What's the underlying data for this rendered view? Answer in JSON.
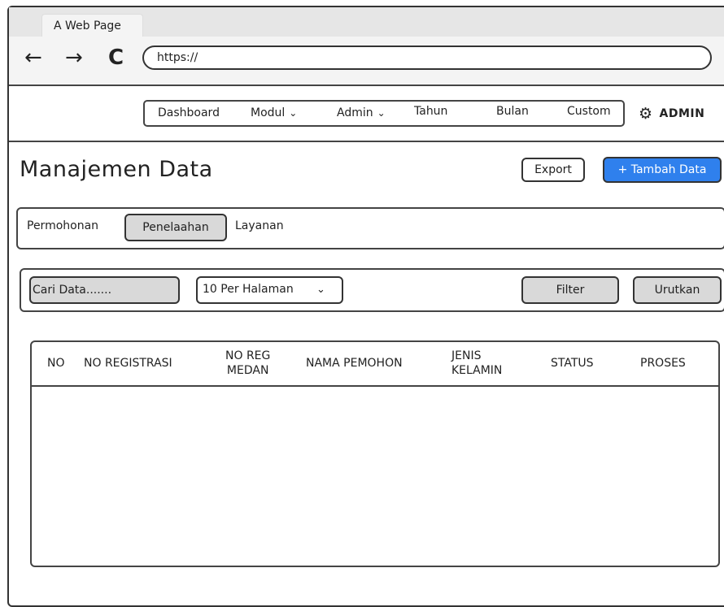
{
  "browser": {
    "tab_title": "A Web Page",
    "url": "https://",
    "back_icon": "←",
    "forward_icon": "→",
    "reload_icon": "C"
  },
  "nav": {
    "items": [
      {
        "label": "Dashboard"
      },
      {
        "label": "Modul",
        "has_dropdown": true
      },
      {
        "label": "Admin",
        "has_dropdown": true
      },
      {
        "label": "Tahun"
      },
      {
        "label": "Bulan"
      },
      {
        "label": "Custom"
      }
    ],
    "chevron": "⌄",
    "user_label": "ADMIN",
    "gear_icon": "⚙"
  },
  "page": {
    "title": "Manajemen Data",
    "export_label": "Export",
    "add_label": "+ Tambah Data",
    "add_color": "#2f80ed"
  },
  "tabs": [
    {
      "label": "Permohonan",
      "active": false
    },
    {
      "label": "Penelaahan",
      "active": true
    },
    {
      "label": "Layanan",
      "active": false
    }
  ],
  "toolbar": {
    "search_placeholder": "Cari Data.......",
    "per_page_value": "10 Per Halaman",
    "filter_label": "Filter",
    "sort_label": "Urutkan"
  },
  "table": {
    "columns": [
      "NO",
      "NO REGISTRASI",
      "NO REG\nMEDAN",
      "NAMA PEMOHON",
      "JENIS\nKELAMIN",
      "STATUS",
      "PROSES"
    ],
    "rows": []
  }
}
